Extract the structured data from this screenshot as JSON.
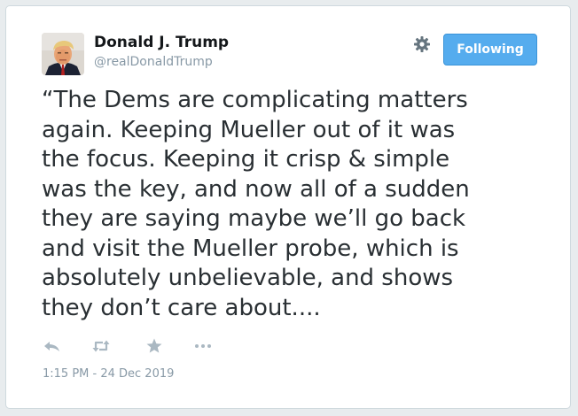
{
  "author": {
    "name": "Donald J. Trump",
    "handle": "@realDonaldTrump"
  },
  "follow_button": {
    "label": "Following"
  },
  "settings": {
    "icon": "gear-icon"
  },
  "tweet": {
    "text": "“The Dems are complicating matters\nagain. Keeping Mueller out of it was\nthe focus. Keeping it crisp & simple\nwas the key, and now all of a sudden\nthey are saying maybe we’ll go back\nand visit the Mueller probe, which is\nabsolutely unbelievable, and shows\nthey don’t care about....",
    "timestamp": "1:15 PM - 24 Dec 2019"
  },
  "actions": [
    {
      "icon": "reply-icon"
    },
    {
      "icon": "retweet-icon"
    },
    {
      "icon": "like-star-icon"
    },
    {
      "icon": "more-icon"
    }
  ],
  "colors": {
    "accent": "#55acee",
    "text": "#292f33",
    "muted": "#8899a6",
    "icon_gray": "#aab8c2"
  }
}
